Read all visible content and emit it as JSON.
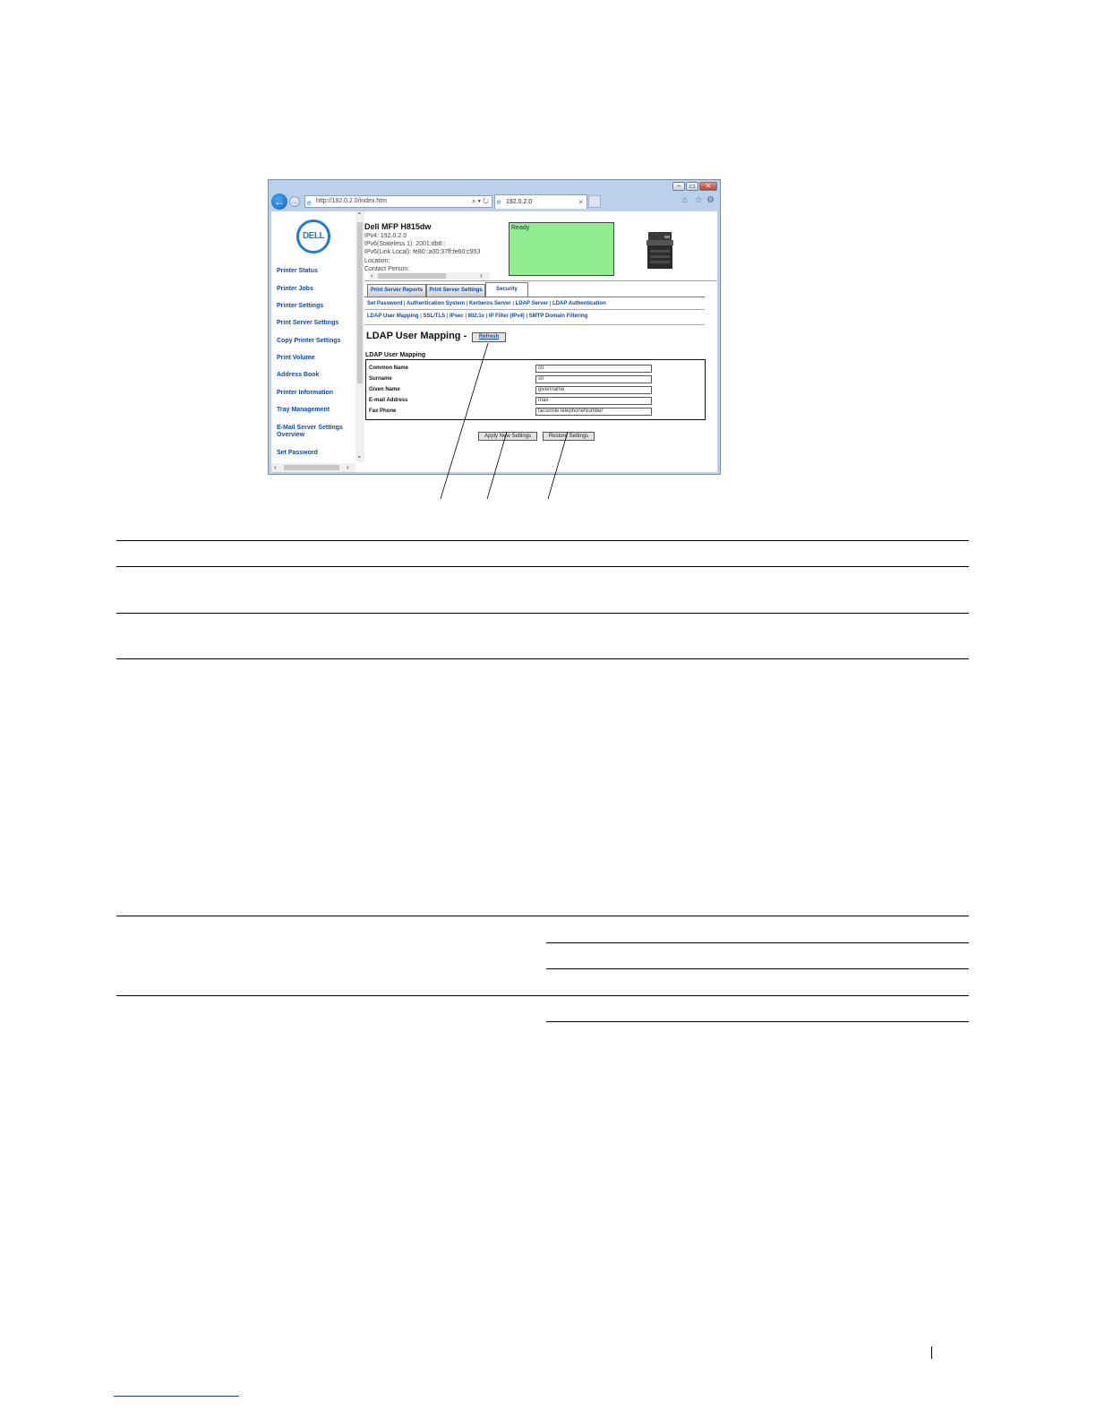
{
  "browser": {
    "address_url": "http://192.0.2.0/index.htm",
    "tab_title": "192.0.2.0",
    "tab_close": "×",
    "back_glyph": "←",
    "fwd_glyph": "→",
    "addr_tools": "⌕ ▾ ↻",
    "minimize": "–",
    "restore": "▭",
    "close": "✕",
    "icons": [
      "home-icon",
      "favorites-star-icon",
      "tools-gear-icon"
    ]
  },
  "nav": {
    "logo": "DELL",
    "items": [
      "Printer Status",
      "Printer Jobs",
      "Printer Settings",
      "Print Server Settings",
      "Copy Printer Settings",
      "Print Volume",
      "Address Book",
      "Printer Information",
      "Tray Management",
      "E-Mail Server Settings Overview",
      "Set Password"
    ]
  },
  "printer": {
    "name": "Dell MFP H815dw",
    "ipv4": "IPv4: 192.0.2.0",
    "ipv6_stateless": "IPv6(Stateless 1): 2001:db8::",
    "ipv6_link": "IPv6(Link Local): fe80::a00:37ff:fe60:c953",
    "location": "Location:",
    "contact": "Contact Person:",
    "status": "Ready"
  },
  "tabs": [
    "Print Server Reports",
    "Print Server Settings",
    "Security"
  ],
  "sublinks_row1": [
    "Set Password",
    "Authentication System",
    "Kerberos Server",
    "LDAP Server",
    "LDAP Authentication"
  ],
  "sublinks_row2": [
    "LDAP User Mapping",
    "SSL/TLS",
    "IPsec",
    "802.1x",
    "IP Filter (IPv4)",
    "SMTP Domain Filtering"
  ],
  "sep": "|",
  "page": {
    "heading": "LDAP User Mapping -",
    "refresh": "Refresh",
    "section_title": "LDAP User Mapping",
    "rows": [
      {
        "label": "Common Name",
        "value": "cn"
      },
      {
        "label": "Surname",
        "value": "sn"
      },
      {
        "label": "Given Name",
        "value": "givenname"
      },
      {
        "label": "E-mail Address",
        "value": "mail"
      },
      {
        "label": "Fax Phone",
        "value": "facsimileTelephoneNumber"
      }
    ],
    "apply_button": "Apply New Settings",
    "restore_button": "Restore Settings"
  },
  "colors": {
    "link": "#0b49b5",
    "status_ready": "#90ee90",
    "dell_blue": "#1f7ad0",
    "window_frame": "#b9d1ea"
  }
}
